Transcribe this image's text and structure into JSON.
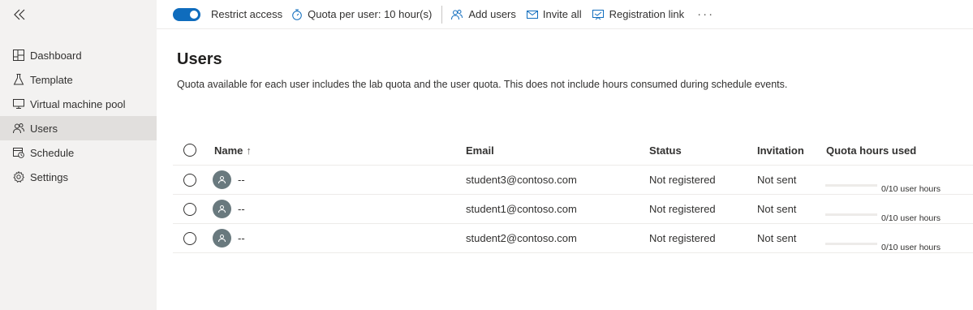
{
  "sidebar": {
    "items": [
      {
        "label": "Dashboard",
        "icon": "dashboard-icon"
      },
      {
        "label": "Template",
        "icon": "beaker-icon"
      },
      {
        "label": "Virtual machine pool",
        "icon": "monitor-icon"
      },
      {
        "label": "Users",
        "icon": "users-icon",
        "active": true
      },
      {
        "label": "Schedule",
        "icon": "calendar-clock-icon"
      },
      {
        "label": "Settings",
        "icon": "gear-icon"
      }
    ]
  },
  "toolbar": {
    "restrict_access": "Restrict access",
    "restrict_access_on": true,
    "quota": "Quota per user: 10 hour(s)",
    "add_users": "Add users",
    "invite_all": "Invite all",
    "registration_link": "Registration link",
    "more": "···"
  },
  "main": {
    "title": "Users",
    "description": "Quota available for each user includes the lab quota and the user quota. This does not include hours consumed during schedule events."
  },
  "table": {
    "columns": {
      "name": "Name",
      "sort_indicator": "↑",
      "email": "Email",
      "status": "Status",
      "invitation": "Invitation",
      "quota": "Quota hours used"
    },
    "rows": [
      {
        "name": "--",
        "email": "student3@contoso.com",
        "status": "Not registered",
        "invitation": "Not sent",
        "quota_label": "0/10 user hours",
        "quota_used_fraction": 0
      },
      {
        "name": "--",
        "email": "student1@contoso.com",
        "status": "Not registered",
        "invitation": "Not sent",
        "quota_label": "0/10 user hours",
        "quota_used_fraction": 0
      },
      {
        "name": "--",
        "email": "student2@contoso.com",
        "status": "Not registered",
        "invitation": "Not sent",
        "quota_label": "0/10 user hours",
        "quota_used_fraction": 0
      }
    ]
  },
  "colors": {
    "accent": "#0f6cbd",
    "sidebar_bg": "#f3f2f1",
    "sidebar_active": "#e1dfdd",
    "avatar_bg": "#69797e"
  }
}
